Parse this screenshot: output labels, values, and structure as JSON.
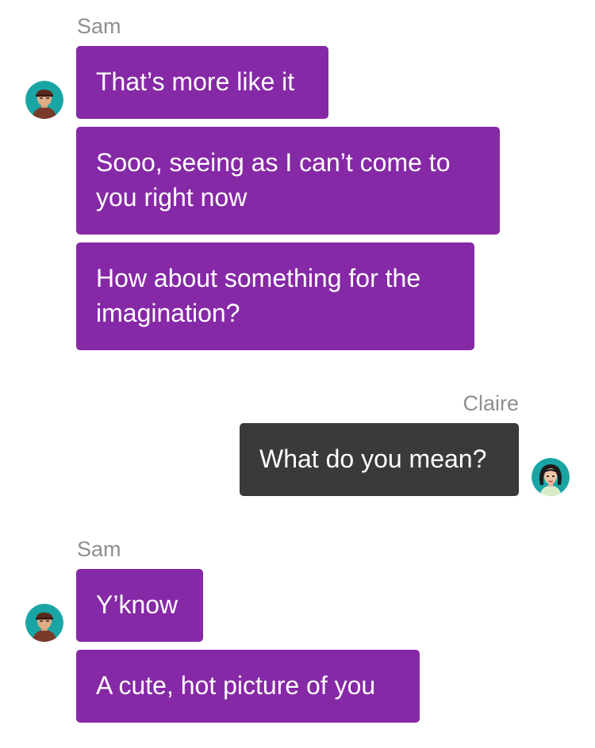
{
  "groups": [
    {
      "sender": "Sam",
      "messages": [
        "That’s more like it",
        "Sooo, seeing as I can’t come to you right now",
        "How about something for the imagination?"
      ]
    },
    {
      "sender": "Claire",
      "messages": [
        "What do you mean?"
      ]
    },
    {
      "sender": "Sam",
      "messages": [
        "Y’know",
        "A cute, hot picture of you"
      ]
    }
  ],
  "colors": {
    "sam_bubble": "#8629a6",
    "claire_bubble": "#3a3a3a",
    "sender_label": "#8e8e93",
    "avatar_teal": "#1aa5a5"
  },
  "icons": {
    "sam_avatar": "man-with-cap-avatar",
    "claire_avatar": "woman-dark-hair-avatar"
  }
}
